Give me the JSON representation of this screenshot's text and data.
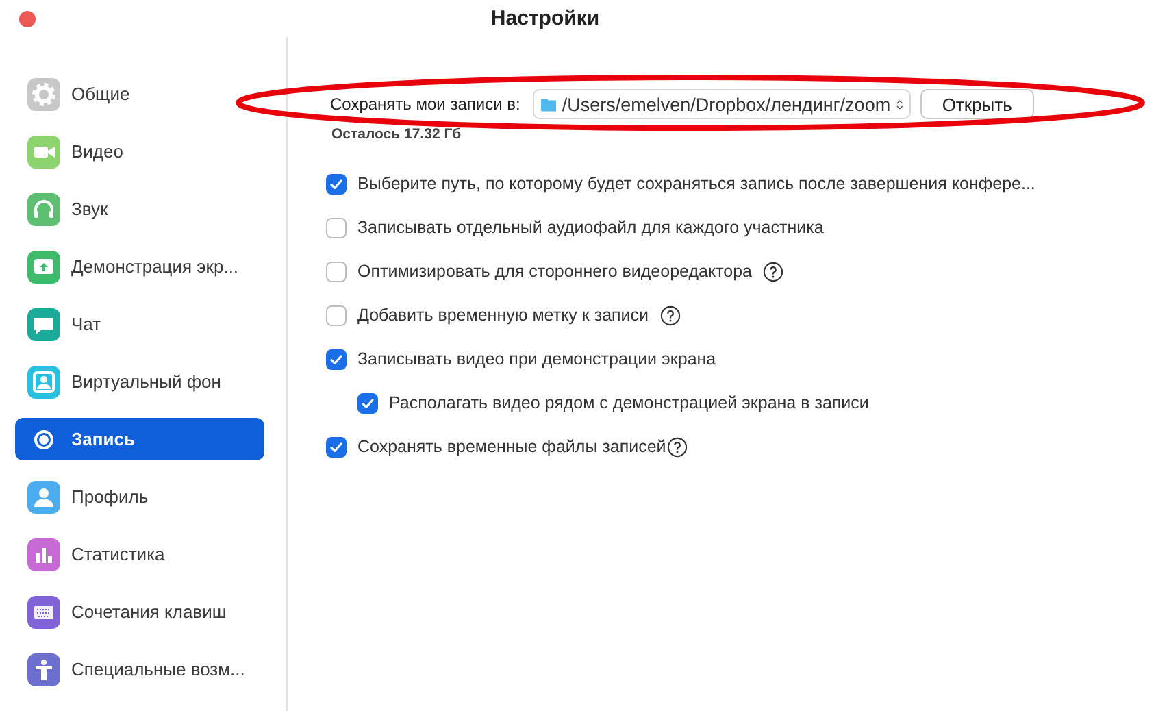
{
  "window": {
    "title": "Настройки"
  },
  "sidebar": {
    "items": [
      {
        "label": "Общие",
        "selected": false,
        "color": "#c8c8c8"
      },
      {
        "label": "Видео",
        "selected": false,
        "color": "#8ed46e"
      },
      {
        "label": "Звук",
        "selected": false,
        "color": "#5cbf72"
      },
      {
        "label": "Демонстрация экр...",
        "selected": false,
        "color": "#3dbb6a"
      },
      {
        "label": "Чат",
        "selected": false,
        "color": "#1ba99a"
      },
      {
        "label": "Виртуальный фон",
        "selected": false,
        "color": "#27bfe2"
      },
      {
        "label": "Запись",
        "selected": true
      },
      {
        "label": "Профиль",
        "selected": false,
        "color": "#4badf0"
      },
      {
        "label": "Статистика",
        "selected": false,
        "color": "#c86ad5"
      },
      {
        "label": "Сочетания клавиш",
        "selected": false,
        "color": "#7f63d7"
      },
      {
        "label": "Специальные возм...",
        "selected": false,
        "color": "#6d6fcf"
      }
    ]
  },
  "location": {
    "label": "Сохранять мои записи в:",
    "path": "/Users/emelven/Dropbox/лендинг/zoom",
    "button": "Открыть",
    "free_space": "Осталось 17.32 Гб"
  },
  "options": [
    {
      "label": "Выберите путь, по которому будет сохраняться запись после завершения конфере...",
      "checked": true,
      "help": false
    },
    {
      "label": "Записывать отдельный аудиофайл для каждого участника",
      "checked": false,
      "help": false
    },
    {
      "label": "Оптимизировать для стороннего видеоредактора",
      "checked": false,
      "help": true
    },
    {
      "label": "Добавить временную метку к записи",
      "checked": false,
      "help": true
    },
    {
      "label": "Записывать видео при демонстрации экрана",
      "checked": true,
      "help": false,
      "children": [
        {
          "label": "Располагать видео рядом с демонстрацией экрана в записи",
          "checked": true,
          "help": false
        }
      ]
    },
    {
      "label": "Сохранять временные файлы записей",
      "checked": true,
      "help": true
    }
  ]
}
